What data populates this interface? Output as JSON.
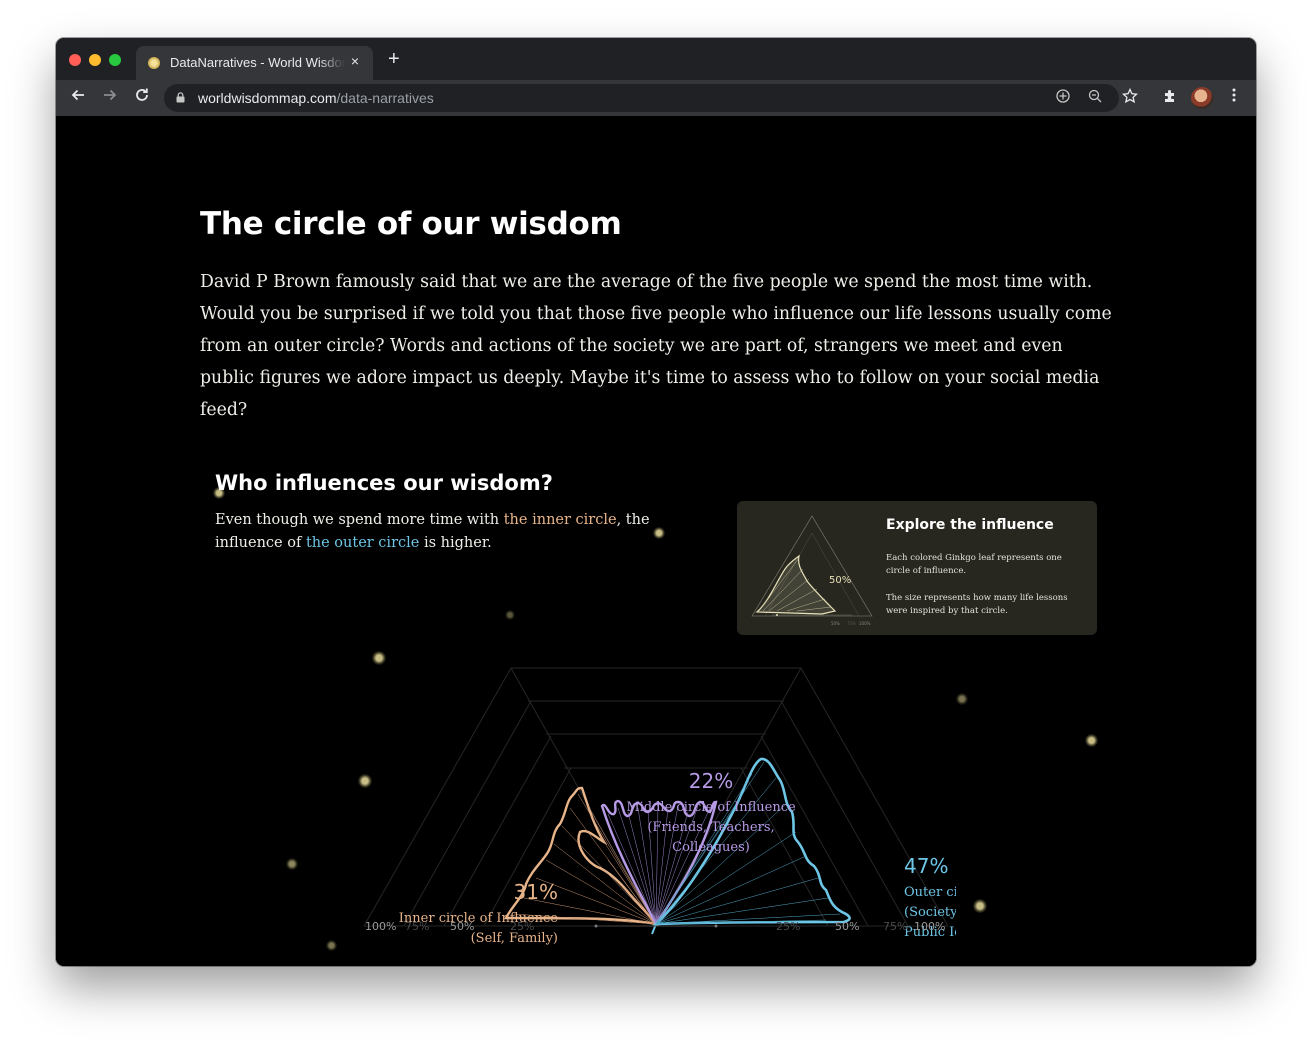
{
  "browser": {
    "tab_title": "DataNarratives - World Wisdom Map",
    "tab_close": "×",
    "new_tab": "+",
    "url_host": "worldwisdommap.com",
    "url_path": "/data-narratives"
  },
  "page": {
    "title": "The circle of our wisdom",
    "intro": "David P Brown famously said that we are the average of the five people we spend the most time with. Would you be surprised if we told you that those five people who influence our life lessons usually come from an outer circle? Words and actions of the society we are part of, strangers we meet and even public figures we adore impact us deeply. Maybe it's time to assess who to follow on your social media feed?"
  },
  "section": {
    "title": "Who influences our wisdom?",
    "sub_1": "Even though we spend more time with ",
    "sub_inner": "the inner circle",
    "sub_2": ", the influence of ",
    "sub_outer": "the outer circle",
    "sub_3": " is higher."
  },
  "explore": {
    "title": "Explore the influence",
    "p1": "Each colored Ginkgo leaf represents one circle of influence.",
    "p2": "The size represents how many life lessons were inspired by that circle.",
    "mini_pct": "50%",
    "mini_ticks": [
      "50%",
      "75%",
      "100%"
    ]
  },
  "chart_data": {
    "type": "other",
    "series": [
      {
        "name": "Inner circle of Influence",
        "detail": "(Self, Family)",
        "value": 31,
        "label": "31%",
        "color": "#e8b48a"
      },
      {
        "name": "Middle circle of Influence",
        "detail": "(Friends, Teachers, Colleagues)",
        "value": 22,
        "label": "22%",
        "color": "#b89be6"
      },
      {
        "name": "Outer circle of Influence",
        "detail": "(Society, Strangers, Public Idols)",
        "value": 47,
        "label": "47%",
        "color": "#6ec6e6"
      }
    ],
    "tick_labels_left": [
      "100%",
      "75%",
      "50%",
      "25%"
    ],
    "tick_labels_right": [
      "25%",
      "50%",
      "75%",
      "100%"
    ]
  },
  "colors": {
    "background": "#000000",
    "inner": "#e8b48a",
    "middle": "#b89be6",
    "outer": "#6ec6e6"
  }
}
